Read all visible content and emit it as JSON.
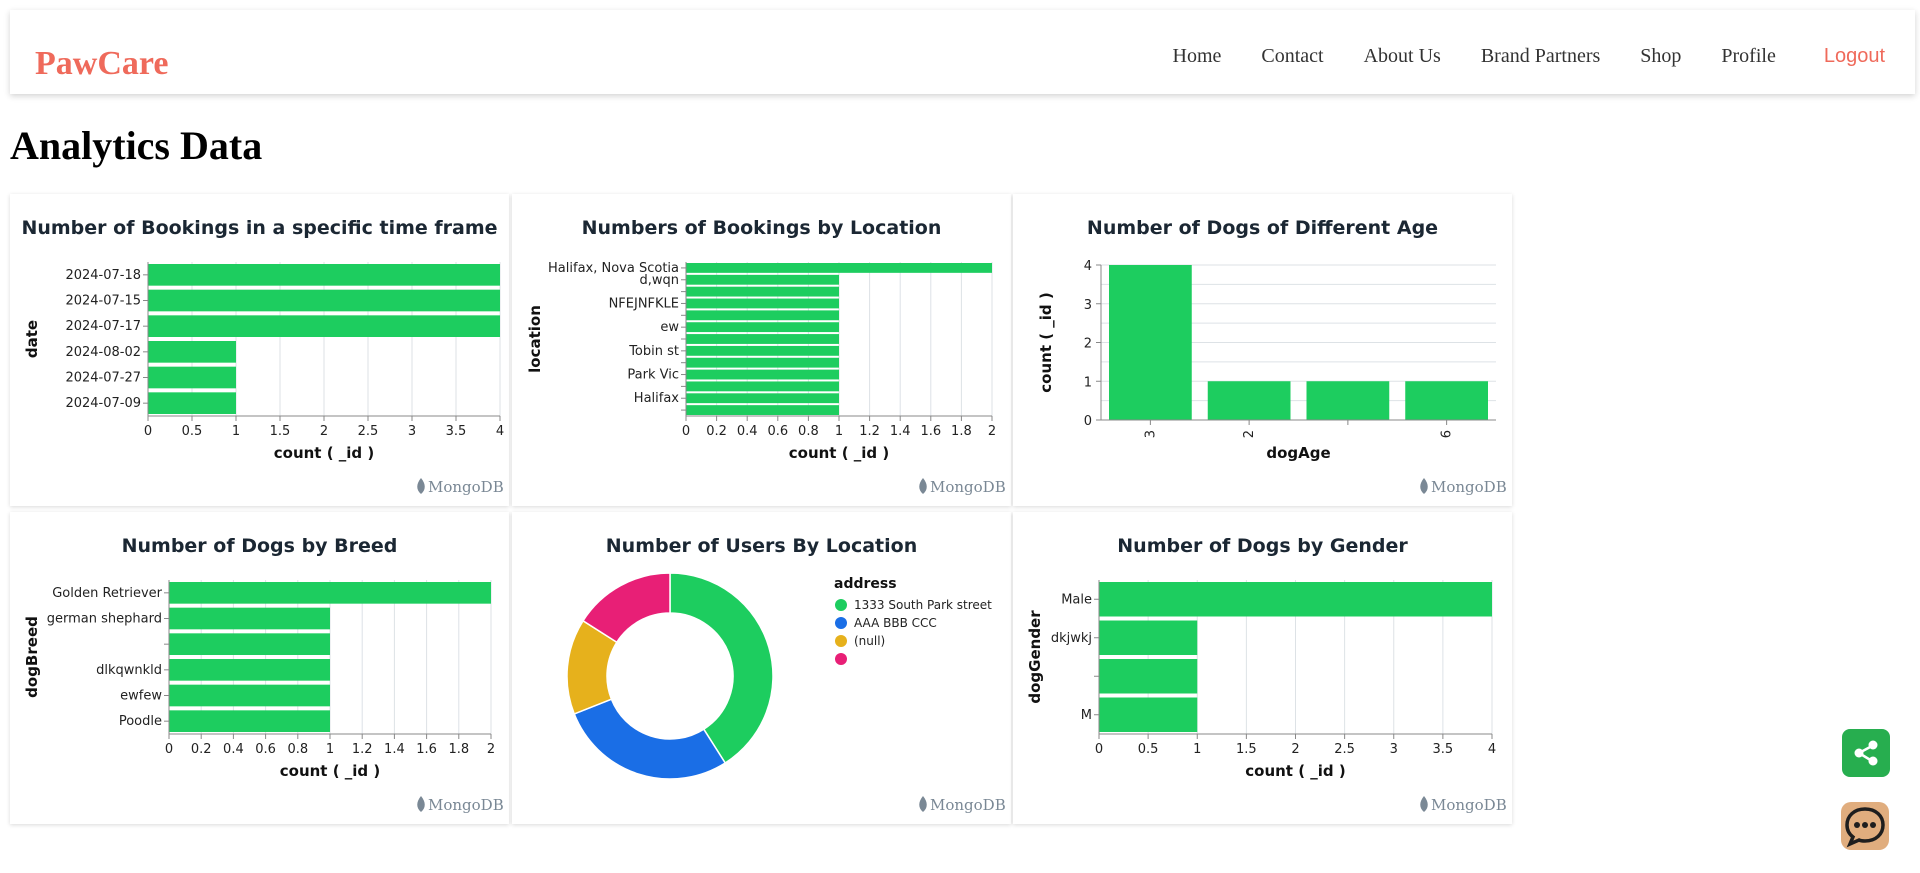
{
  "header": {
    "brand": "PawCare",
    "nav": [
      {
        "label": "Home",
        "name": "nav-home"
      },
      {
        "label": "Contact",
        "name": "nav-contact"
      },
      {
        "label": "About Us",
        "name": "nav-about-us"
      },
      {
        "label": "Brand Partners",
        "name": "nav-brand-partners"
      },
      {
        "label": "Shop",
        "name": "nav-shop"
      },
      {
        "label": "Profile",
        "name": "nav-profile"
      }
    ],
    "logout": "Logout"
  },
  "page_title": "Analytics Data",
  "watermark": "MongoDB",
  "colors": {
    "bar": "#1dcd5f",
    "brand": "#ef6a5b",
    "share_button": "#27ae4f",
    "chat_button": "#e0ad7e"
  },
  "icons": {
    "share": "share-icon",
    "chat": "chat-icon",
    "watermark": "mongodb-leaf-icon"
  },
  "chart_data": [
    {
      "type": "bar",
      "orientation": "horizontal",
      "title": "Number of Bookings in a specific time frame",
      "categories": [
        "2024-07-18",
        "2024-07-15",
        "2024-07-17",
        "2024-08-02",
        "2024-07-27",
        "2024-07-09"
      ],
      "values": [
        4,
        4,
        4,
        1,
        1,
        1
      ],
      "xlabel": "count ( _id )",
      "ylabel": "date",
      "xlim": [
        0,
        4
      ],
      "xticks": [
        "0",
        "0.5",
        "1",
        "1.5",
        "2",
        "2.5",
        "3",
        "3.5",
        "4"
      ],
      "grid": true
    },
    {
      "type": "bar",
      "orientation": "horizontal",
      "title": "Numbers of Bookings by Location",
      "categories": [
        "Halifax, Nova Scotia",
        "d,wqn",
        "",
        "NFEJNFKLE",
        "",
        "ew",
        "",
        "Tobin st",
        "",
        "Park Vic",
        "",
        "Halifax",
        ""
      ],
      "values": [
        2,
        1,
        1,
        1,
        1,
        1,
        1,
        1,
        1,
        1,
        1,
        1,
        1
      ],
      "xlabel": "count ( _id )",
      "ylabel": "location",
      "xlim": [
        0,
        2
      ],
      "xticks": [
        "0",
        "0.2",
        "0.4",
        "0.6",
        "0.8",
        "1",
        "1.2",
        "1.4",
        "1.6",
        "1.8",
        "2"
      ],
      "grid": true
    },
    {
      "type": "bar",
      "orientation": "vertical",
      "title": "Number of Dogs of Different Age",
      "categories": [
        "3",
        "2",
        "",
        "6"
      ],
      "values": [
        4,
        1,
        1,
        1
      ],
      "xlabel": "dogAge",
      "ylabel": "count ( _id )",
      "ylim": [
        0,
        4
      ],
      "yticks": [
        "0",
        "1",
        "2",
        "3",
        "4"
      ],
      "grid": true
    },
    {
      "type": "bar",
      "orientation": "horizontal",
      "title": "Number of Dogs by Breed",
      "categories": [
        "Golden Retriever",
        "german shephard",
        "",
        "dlkqwnkld",
        "ewfew",
        "Poodle"
      ],
      "values": [
        2,
        1,
        1,
        1,
        1,
        1
      ],
      "xlabel": "count ( _id )",
      "ylabel": "dogBreed",
      "xlim": [
        0,
        2
      ],
      "xticks": [
        "0",
        "0.2",
        "0.4",
        "0.6",
        "0.8",
        "1",
        "1.2",
        "1.4",
        "1.6",
        "1.8",
        "2"
      ],
      "grid": true
    },
    {
      "type": "pie",
      "donut": true,
      "title": "Number of Users By Location",
      "legend_title": "address",
      "legend_position": "right",
      "labels": [
        "1333 South Park street",
        "AAA BBB CCC",
        "(null)",
        ""
      ],
      "values": [
        41,
        28,
        15,
        16
      ],
      "colors": [
        "#1dcd5f",
        "#1a6ee6",
        "#e6b11c",
        "#e81f76"
      ]
    },
    {
      "type": "bar",
      "orientation": "horizontal",
      "title": "Number of Dogs by Gender",
      "categories": [
        "Male",
        "dkjwkj",
        "",
        "M"
      ],
      "values": [
        4,
        1,
        1,
        1
      ],
      "xlabel": "count ( _id )",
      "ylabel": "dogGender",
      "xlim": [
        0,
        4
      ],
      "xticks": [
        "0",
        "0.5",
        "1",
        "1.5",
        "2",
        "2.5",
        "3",
        "3.5",
        "4"
      ],
      "grid": true
    }
  ]
}
